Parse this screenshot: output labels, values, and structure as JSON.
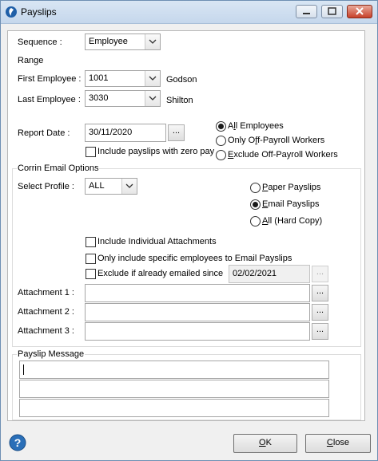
{
  "window": {
    "title": "Payslips"
  },
  "sequence": {
    "label": "Sequence :",
    "value": "Employee"
  },
  "range": {
    "title": "Range",
    "first_label": "First Employee :",
    "first_value": "1001",
    "first_name": "Godson",
    "last_label": "Last Employee :",
    "last_value": "3030",
    "last_name": "Shilton"
  },
  "report": {
    "label": "Report Date :",
    "value": "30/11/2020",
    "zero_pay_label": "Include payslips with zero pay"
  },
  "employees_filter": {
    "options": [
      {
        "pre": "A",
        "ul": "l",
        "post": "l Employees",
        "checked": true
      },
      {
        "pre": "Only O",
        "ul": "f",
        "post": "f-Payroll Workers",
        "checked": false
      },
      {
        "pre": "",
        "ul": "E",
        "post": "xclude Off-Payroll Workers",
        "checked": false
      }
    ]
  },
  "email": {
    "title": "Corrin Email Options",
    "profile_label": "Select Profile :",
    "profile_value": "ALL",
    "payslip_options": [
      {
        "pre": "",
        "ul": "P",
        "post": "aper Payslips",
        "checked": false
      },
      {
        "pre": "",
        "ul": "E",
        "post": "mail Payslips",
        "checked": true
      },
      {
        "pre": "",
        "ul": "A",
        "post": "ll (Hard Copy)",
        "checked": false
      }
    ],
    "include_attachments_label": "Include Individual Attachments",
    "specific_employees_label": "Only include specific employees to Email Payslips",
    "exclude_emailed_label": "Exclude if already emailed since",
    "exclude_date": "02/02/2021",
    "attachments": [
      {
        "label": "Attachment 1 :",
        "value": ""
      },
      {
        "label": "Attachment 2 :",
        "value": ""
      },
      {
        "label": "Attachment 3 :",
        "value": ""
      }
    ],
    "ellipsis": "..."
  },
  "message": {
    "title": "Payslip Message",
    "lines": [
      "",
      "",
      ""
    ]
  },
  "buttons": {
    "ok_ul": "O",
    "ok_rest": "K",
    "close_ul": "C",
    "close_rest": "lose"
  },
  "colors": {
    "titlebar": "#c5d7ec",
    "close_button": "#c7412a",
    "help_icon": "#2a6fb8"
  }
}
